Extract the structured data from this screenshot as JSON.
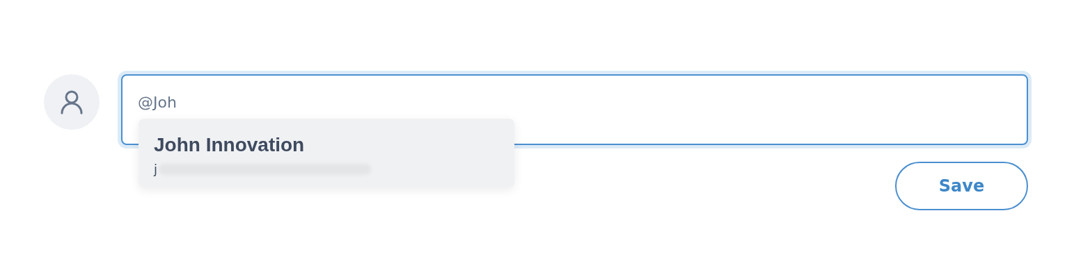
{
  "comment_field": {
    "value": "@Joh"
  },
  "mention_suggestions": [
    {
      "name": "John Innovation",
      "email": "j"
    }
  ],
  "save_button": {
    "label": "Save"
  }
}
